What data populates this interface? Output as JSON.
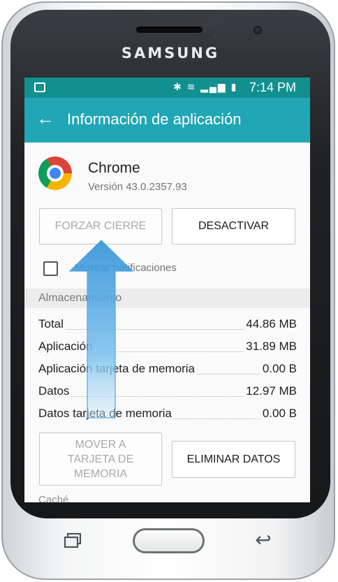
{
  "device": {
    "brand": "SAMSUNG"
  },
  "status_bar": {
    "icons": "✱ ≋ ▂▄▆ ▮",
    "time": "7:14 PM"
  },
  "app_bar": {
    "back_icon": "←",
    "title": "Información de aplicación"
  },
  "app": {
    "name": "Chrome",
    "version": "Versión 43.0.2357.93"
  },
  "buttons": {
    "force_stop": "FORZAR CIERRE",
    "disable": "DESACTIVAR",
    "move_line1": "MOVER A",
    "move_line2": "TARJETA DE",
    "move_line3": "MEMORIA",
    "clear_data": "ELIMINAR DATOS"
  },
  "notifications": {
    "label": "Mostrar notificaciones",
    "checked": false
  },
  "storage": {
    "header": "Almacenamiento",
    "rows": [
      {
        "label": "Total",
        "value": "44.86 MB"
      },
      {
        "label": "Aplicación",
        "value": "31.89 MB"
      },
      {
        "label": "Aplicación tarjeta de memoria",
        "value": "0.00 B"
      },
      {
        "label": "Datos",
        "value": "12.97 MB"
      },
      {
        "label": "Datos tarjeta de memoria",
        "value": "0.00 B"
      }
    ]
  },
  "cache": {
    "header": "Caché"
  },
  "nav": {
    "back_icon": "↩"
  },
  "colors": {
    "status_bar": "#11908f",
    "app_bar": "#21a6b5",
    "arrow": "#3aa0db"
  }
}
